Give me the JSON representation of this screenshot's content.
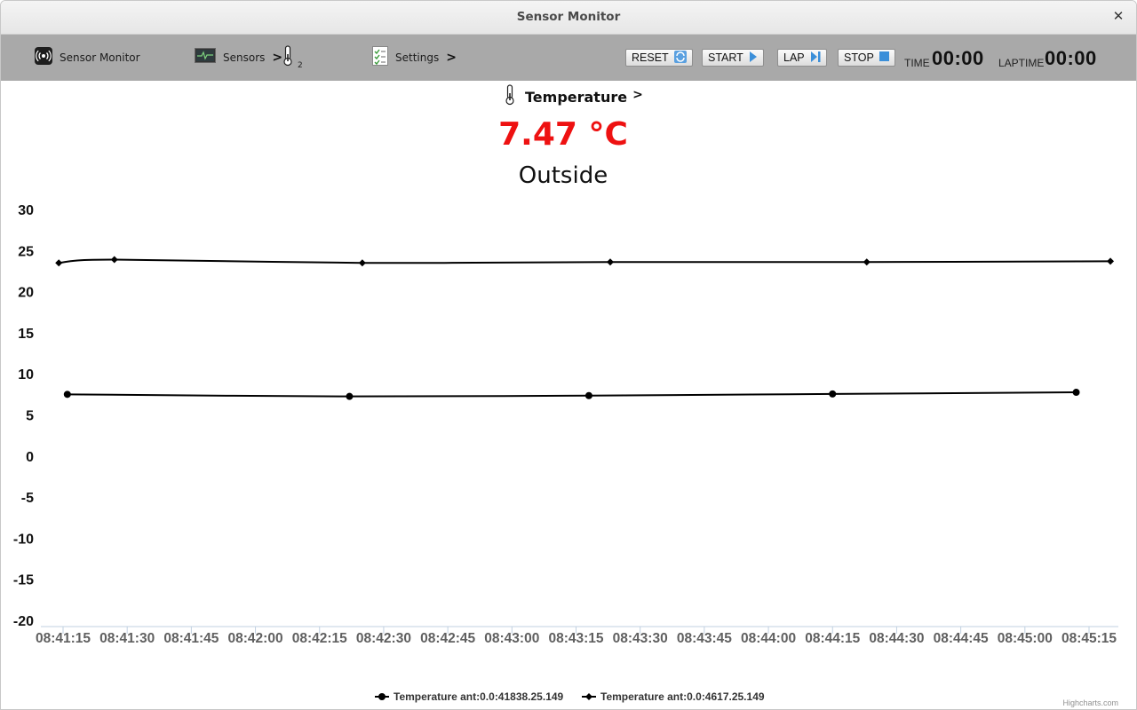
{
  "window": {
    "title": "Sensor Monitor",
    "close_glyph": "✕"
  },
  "toolbar": {
    "app_label": "Sensor Monitor",
    "sensors_label": "Sensors",
    "sensors_chevron": ">",
    "sensor_count": "2",
    "settings_label": "Settings",
    "settings_chevron": ">",
    "reset_label": "RESET",
    "start_label": "START",
    "lap_label": "LAP",
    "stop_label": "STOP",
    "time_label": "TIME",
    "time_value": "00:00",
    "laptime_label": "LAPTIME",
    "laptime_value": "00:00"
  },
  "sensor": {
    "name": "Temperature",
    "chevron": ">",
    "reading": "7.47 °C",
    "location": "Outside"
  },
  "credit": "Highcharts.com",
  "colors": {
    "reading": "#ee1111",
    "toolbar": "#a9a9a9",
    "line": "#000000"
  },
  "chart_data": {
    "type": "line",
    "title": "",
    "xlabel": "",
    "ylabel": "",
    "ylim": [
      -20,
      30
    ],
    "yticks": [
      30,
      25,
      20,
      15,
      10,
      5,
      0,
      -5,
      -10,
      -15,
      -20
    ],
    "x_range": [
      "08:41:15",
      "08:45:15"
    ],
    "xticks": [
      "08:41:15",
      "08:41:30",
      "08:41:45",
      "08:42:00",
      "08:42:15",
      "08:42:30",
      "08:42:45",
      "08:43:00",
      "08:43:15",
      "08:43:30",
      "08:43:45",
      "08:44:00",
      "08:44:15",
      "08:44:30",
      "08:44:45",
      "08:45:00",
      "08:45:15"
    ],
    "grid": false,
    "legend_position": "bottom",
    "series": [
      {
        "name": "Temperature ant:0.0:41838.25.149",
        "marker": "circle",
        "points": [
          {
            "x": "08:41:16",
            "y": 7.5
          },
          {
            "x": "08:42:22",
            "y": 7.25
          },
          {
            "x": "08:43:18",
            "y": 7.35
          },
          {
            "x": "08:44:15",
            "y": 7.55
          },
          {
            "x": "08:45:12",
            "y": 7.75
          }
        ]
      },
      {
        "name": "Temperature ant:0.0:4617.25.149",
        "marker": "diamond",
        "points": [
          {
            "x": "08:41:14",
            "y": 23.5
          },
          {
            "x": "08:41:27",
            "y": 23.9
          },
          {
            "x": "08:42:25",
            "y": 23.5
          },
          {
            "x": "08:43:23",
            "y": 23.6
          },
          {
            "x": "08:44:23",
            "y": 23.6
          },
          {
            "x": "08:45:20",
            "y": 23.7
          }
        ]
      }
    ]
  }
}
